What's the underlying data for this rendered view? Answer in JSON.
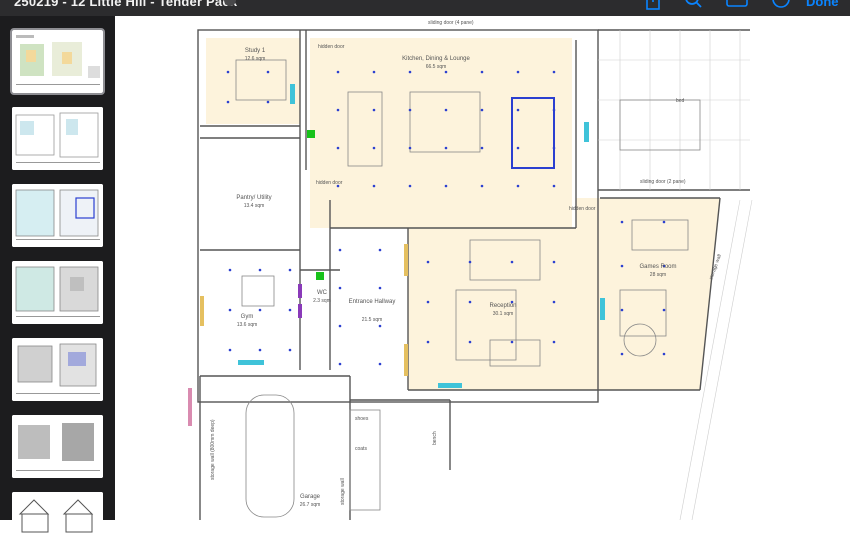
{
  "window": {
    "title": "250219 - 12 Little Hill - Tender Pack",
    "done_label": "Done"
  },
  "toolbar": {
    "icons": [
      "share-icon",
      "search-icon",
      "annotate-icon",
      "markup-icon"
    ]
  },
  "sidebar": {
    "pages": [
      {
        "label": "Page 1"
      },
      {
        "label": "Page 2"
      },
      {
        "label": "Page 3"
      },
      {
        "label": "Page 4"
      },
      {
        "label": "Page 5"
      },
      {
        "label": "Page 6"
      },
      {
        "label": "Page 7"
      }
    ]
  },
  "plan": {
    "rooms": [
      {
        "name": "Study 1",
        "area": "12.6 sqm"
      },
      {
        "name": "Kitchen, Dining & Lounge",
        "area": "66.5 sqm"
      },
      {
        "name": "Pantry/ Utility",
        "area": "13.4 sqm"
      },
      {
        "name": "Gym",
        "area": "13.6 sqm"
      },
      {
        "name": "WC",
        "area": "2.3 sqm"
      },
      {
        "name": "Entrance Hallway",
        "area": "21.5 sqm"
      },
      {
        "name": "Reception",
        "area": "30.1 sqm"
      },
      {
        "name": "Games Room",
        "area": "28 sqm"
      },
      {
        "name": "Garage",
        "area": "26.7 sqm"
      }
    ],
    "labels": {
      "sliding_door_top": "sliding door (4 pane)",
      "sliding_door_right": "sliding door (2 pane)",
      "hidden_door_1": "hidden door",
      "hidden_door_2": "hidden door",
      "hidden_door_3": "hidden door",
      "storage_wall_garage": "storage wall (800mm deep)",
      "storage_wall_hall": "storage wall",
      "bench": "bench",
      "storage_wall_games": "storage wall",
      "shoes": "shoes",
      "coats": "coats",
      "bed_label": "bed"
    }
  },
  "colors": {
    "topbar": "#2c2c2e",
    "sidebar": "#1c1c1e",
    "accent": "#0a84ff",
    "room_fill": "#fdf3dc",
    "dot": "#2b3fd0"
  }
}
